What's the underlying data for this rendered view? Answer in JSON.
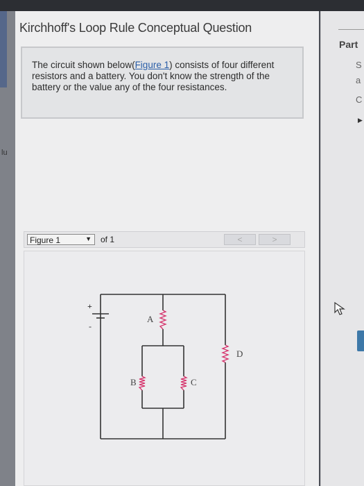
{
  "question": {
    "title": "Kirchhoff's Loop Rule Conceptual Question",
    "text_before_link": "The circuit shown below(",
    "link": "Figure 1",
    "text_after_link": ") consists of four different resistors and a battery. You don't know the strength of the battery or the value any of the four resistances."
  },
  "figure_nav": {
    "selected": "Figure 1",
    "of_label": "of 1",
    "prev_glyph": "<",
    "next_glyph": ">"
  },
  "circuit": {
    "battery_plus": "+",
    "battery_minus": "-",
    "resistors": [
      "A",
      "B",
      "C",
      "D"
    ],
    "wire_color": "#333333",
    "resistor_color": "#d6336c"
  },
  "right_panel": {
    "part_label": "Part",
    "fragments": [
      "S",
      "a",
      "C"
    ]
  },
  "left_panel": {
    "fragment": "lu"
  }
}
